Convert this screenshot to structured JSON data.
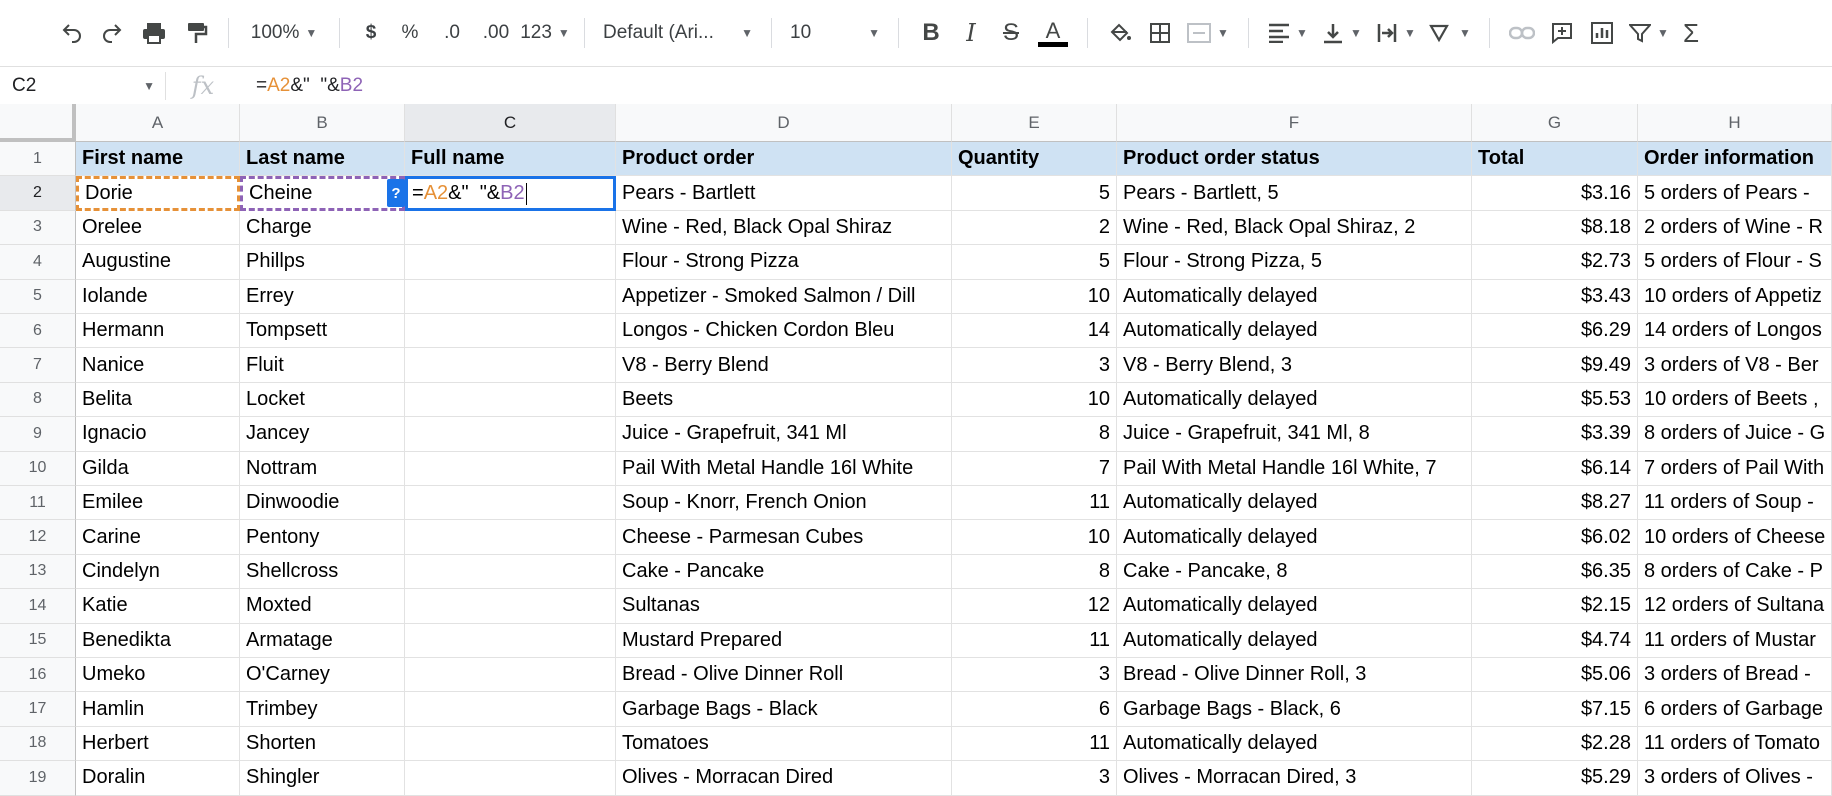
{
  "toolbar": {
    "zoom": "100%",
    "currency": "$",
    "percent": "%",
    "dec_decrease": ".0",
    "dec_increase": ".00",
    "format_more": "123",
    "font": "Default (Ari...",
    "font_size": "10"
  },
  "formula_bar": {
    "name_box": "C2",
    "fx": "fx",
    "formula_prefix": "=",
    "formula_ref_a": "A2",
    "formula_mid": "&\"  \"&",
    "formula_ref_b": "B2"
  },
  "columns": [
    "A",
    "B",
    "C",
    "D",
    "E",
    "F",
    "G",
    "H"
  ],
  "rows": [
    "1",
    "2",
    "3",
    "4",
    "5",
    "6",
    "7",
    "8",
    "9",
    "10",
    "11",
    "12",
    "13",
    "14",
    "15",
    "16",
    "17",
    "18",
    "19"
  ],
  "header": [
    "First name",
    "Last name",
    "Full name",
    "Product order",
    "Quantity",
    "Product order status",
    "Total",
    "Order information"
  ],
  "data": [
    [
      "Dorie",
      "Cheine",
      "",
      "Pears - Bartlett",
      "5",
      "Pears - Bartlett, 5",
      "$3.16",
      "5 orders of Pears -"
    ],
    [
      "Orelee",
      "Charge",
      "",
      "Wine - Red, Black Opal Shiraz",
      "2",
      "Wine - Red, Black Opal Shiraz, 2",
      "$8.18",
      "2 orders of Wine - R"
    ],
    [
      "Augustine",
      "Phillps",
      "",
      "Flour - Strong Pizza",
      "5",
      "Flour - Strong Pizza, 5",
      "$2.73",
      "5 orders of Flour - S"
    ],
    [
      "Iolande",
      "Errey",
      "",
      "Appetizer - Smoked Salmon / Dill",
      "10",
      "Automatically delayed",
      "$3.43",
      "10 orders of Appetiz"
    ],
    [
      "Hermann",
      "Tompsett",
      "",
      "Longos - Chicken Cordon Bleu",
      "14",
      "Automatically delayed",
      "$6.29",
      "14 orders of Longos"
    ],
    [
      "Nanice",
      "Fluit",
      "",
      "V8 - Berry Blend",
      "3",
      "V8 - Berry Blend, 3",
      "$9.49",
      "3 orders of V8 - Ber"
    ],
    [
      "Belita",
      "Locket",
      "",
      "Beets",
      "10",
      "Automatically delayed",
      "$5.53",
      "10 orders of Beets ,"
    ],
    [
      "Ignacio",
      "Jancey",
      "",
      "Juice - Grapefruit, 341 Ml",
      "8",
      "Juice - Grapefruit, 341 Ml, 8",
      "$3.39",
      "8 orders of Juice - G"
    ],
    [
      "Gilda",
      "Nottram",
      "",
      "Pail With Metal Handle 16l White",
      "7",
      "Pail With Metal Handle 16l White, 7",
      "$6.14",
      "7 orders of Pail With"
    ],
    [
      "Emilee",
      "Dinwoodie",
      "",
      "Soup - Knorr, French Onion",
      "11",
      "Automatically delayed",
      "$8.27",
      "11 orders of Soup -"
    ],
    [
      "Carine",
      "Pentony",
      "",
      "Cheese - Parmesan Cubes",
      "10",
      "Automatically delayed",
      "$6.02",
      "10 orders of Cheese"
    ],
    [
      "Cindelyn",
      "Shellcross",
      "",
      "Cake - Pancake",
      "8",
      "Cake - Pancake, 8",
      "$6.35",
      "8 orders of Cake - P"
    ],
    [
      "Katie",
      "Moxted",
      "",
      "Sultanas",
      "12",
      "Automatically delayed",
      "$2.15",
      "12 orders of Sultana"
    ],
    [
      "Benedikta",
      "Armatage",
      "",
      "Mustard Prepared",
      "11",
      "Automatically delayed",
      "$4.74",
      "11 orders of Mustar"
    ],
    [
      "Umeko",
      "O'Carney",
      "",
      "Bread - Olive Dinner Roll",
      "3",
      "Bread - Olive Dinner Roll, 3",
      "$5.06",
      "3 orders of Bread -"
    ],
    [
      "Hamlin",
      "Trimbey",
      "",
      "Garbage Bags - Black",
      "6",
      "Garbage Bags - Black, 6",
      "$7.15",
      "6 orders of Garbage"
    ],
    [
      "Herbert",
      "Shorten",
      "",
      "Tomatoes",
      "11",
      "Automatically delayed",
      "$2.28",
      "11 orders of Tomato"
    ],
    [
      "Doralin",
      "Shingler",
      "",
      "Olives - Morracan Dired",
      "3",
      "Olives - Morracan Dired, 3",
      "$5.29",
      "3 orders of Olives -"
    ]
  ],
  "editing_cell": {
    "badge": "?",
    "prefix": "=",
    "ref_a": "A2",
    "mid": "&\"  \"&",
    "ref_b": "B2"
  }
}
